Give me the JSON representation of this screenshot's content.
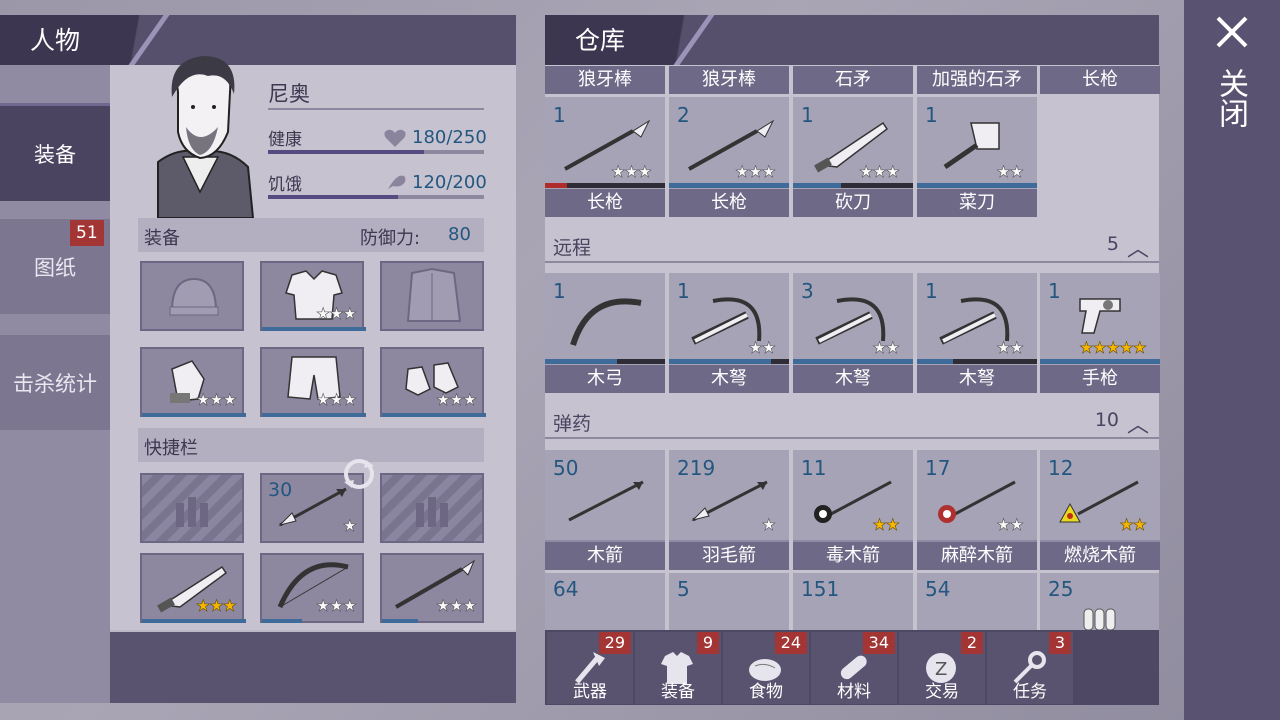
{
  "left_panel": {
    "header_title": "人物",
    "side_tabs": [
      {
        "label": "装备",
        "badge": ""
      },
      {
        "label": "图纸",
        "badge": "51"
      },
      {
        "label": "击杀统计",
        "badge": ""
      }
    ],
    "character": {
      "name": "尼奥",
      "health_label": "健康",
      "health_value": "180/250",
      "health_fraction": 0.72,
      "hunger_label": "饥饿",
      "hunger_value": "120/200",
      "hunger_fraction": 0.6
    },
    "equipment": {
      "title": "装备",
      "defense_label": "防御力:",
      "defense_value": "80",
      "slots": [
        {
          "icon": "beanie-hat-icon",
          "stars": 0
        },
        {
          "icon": "hoodie-icon",
          "stars": 3
        },
        {
          "icon": "jacket-icon",
          "stars": 0
        },
        {
          "icon": "gloves-icon",
          "stars": 3
        },
        {
          "icon": "shorts-icon",
          "stars": 3
        },
        {
          "icon": "sneakers-icon",
          "stars": 3
        }
      ]
    },
    "quickbar": {
      "title": "快捷栏",
      "slots": [
        {
          "icon": "ammo-placeholder-icon",
          "count": "",
          "stars": 0
        },
        {
          "icon": "feather-arrow-icon",
          "count": "30",
          "stars": 1
        },
        {
          "icon": "ammo-placeholder-icon",
          "count": "",
          "stars": 0
        },
        {
          "icon": "machete-icon",
          "count": "",
          "stars": 3,
          "gold": true
        },
        {
          "icon": "bow-icon",
          "count": "",
          "stars": 3
        },
        {
          "icon": "spear-icon",
          "count": "",
          "stars": 3
        }
      ]
    }
  },
  "warehouse": {
    "header_title": "仓库",
    "top_labels": [
      "狼牙棒",
      "狼牙棒",
      "石矛",
      "加强的石矛",
      "长枪"
    ],
    "melee": [
      {
        "count": "1",
        "label": "长枪",
        "stars": 3,
        "durability": 0.18,
        "dur_color": "#b02b2b"
      },
      {
        "count": "2",
        "label": "长枪",
        "stars": 3,
        "durability": 1.0,
        "dur_color": "#3e6b9a"
      },
      {
        "count": "1",
        "label": "砍刀",
        "stars": 3,
        "durability": 0.4,
        "dur_color": "#3e6b9a"
      },
      {
        "count": "1",
        "label": "菜刀",
        "stars": 2,
        "durability": 1.0,
        "dur_color": "#3e6b9a"
      }
    ],
    "ranged": {
      "title": "远程",
      "count": "5",
      "items": [
        {
          "count": "1",
          "label": "木弓",
          "stars": 0,
          "durability": 0.6
        },
        {
          "count": "1",
          "label": "木弩",
          "stars": 2,
          "durability": 0.85
        },
        {
          "count": "3",
          "label": "木弩",
          "stars": 2,
          "durability": 1.0
        },
        {
          "count": "1",
          "label": "木弩",
          "stars": 2,
          "durability": 0.3
        },
        {
          "count": "1",
          "label": "手枪",
          "stars": 5,
          "durability": 1.0,
          "gold": true
        }
      ]
    },
    "ammo": {
      "title": "弹药",
      "count": "10",
      "items": [
        {
          "count": "50",
          "label": "木箭",
          "stars": 0
        },
        {
          "count": "219",
          "label": "羽毛箭",
          "stars": 1
        },
        {
          "count": "11",
          "label": "毒木箭",
          "stars": 2,
          "gold": true
        },
        {
          "count": "17",
          "label": "麻醉木箭",
          "stars": 2
        },
        {
          "count": "12",
          "label": "燃烧木箭",
          "stars": 2,
          "gold": true
        }
      ],
      "partial_counts": [
        "64",
        "5",
        "151",
        "54",
        "25"
      ]
    }
  },
  "bottom_tabs": [
    {
      "label": "武器",
      "badge": "29"
    },
    {
      "label": "装备",
      "badge": "9"
    },
    {
      "label": "食物",
      "badge": "24"
    },
    {
      "label": "材料",
      "badge": "34"
    },
    {
      "label": "交易",
      "badge": "2"
    },
    {
      "label": "任务",
      "badge": "3"
    }
  ],
  "close": {
    "label": "关闭"
  }
}
